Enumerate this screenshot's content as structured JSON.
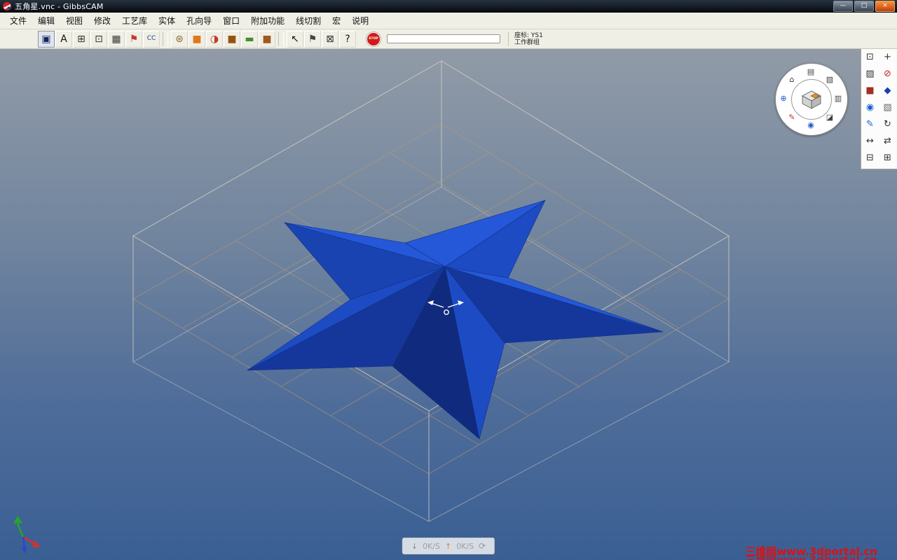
{
  "window": {
    "title": "五角星.vnc - GibbsCAM",
    "controls": [
      {
        "name": "minimize-button",
        "glyph": "—"
      },
      {
        "name": "maximize-button",
        "glyph": "□"
      },
      {
        "name": "close-button",
        "glyph": "×"
      }
    ]
  },
  "menu": {
    "items": [
      "文件",
      "编辑",
      "视图",
      "修改",
      "工艺库",
      "实体",
      "孔向导",
      "窗口",
      "附加功能",
      "线切割",
      "宏",
      "说明"
    ]
  },
  "toolbar": {
    "buttons": [
      {
        "name": "document-view-button",
        "glyph": "▣",
        "fg": "#12235e",
        "pressed": true
      },
      {
        "name": "text-tool-button",
        "glyph": "A",
        "fg": "#111111"
      },
      {
        "name": "sheet-stack-button",
        "glyph": "⊞",
        "fg": "#333333"
      },
      {
        "name": "marquee-select-button",
        "glyph": "⊡",
        "fg": "#333333"
      },
      {
        "name": "grid-toggle-button",
        "glyph": "▦",
        "fg": "#333333"
      },
      {
        "name": "flag-tool-button",
        "glyph": "⚑",
        "fg": "#c03a2a"
      },
      {
        "name": "cc-tool-button",
        "glyph": "CC",
        "fg": "#23408e"
      },
      {
        "type": "sep"
      },
      {
        "name": "blade-tool-button",
        "glyph": "⊛",
        "fg": "#8a6a2a"
      },
      {
        "name": "stock-solid-button",
        "glyph": "■",
        "fg": "#e07818"
      },
      {
        "name": "revolve-solid-button",
        "glyph": "◑",
        "fg": "#c0392b"
      },
      {
        "name": "block-solid-button",
        "glyph": "■",
        "fg": "#96520f"
      },
      {
        "name": "sweep-solid-button",
        "glyph": "▬",
        "fg": "#3f8f2f"
      },
      {
        "name": "body-solid-button",
        "glyph": "■",
        "fg": "#a05a20"
      },
      {
        "type": "sep"
      },
      {
        "name": "cursor-tool-button",
        "glyph": "↖",
        "fg": "#111111"
      },
      {
        "name": "flag-small-button",
        "glyph": "⚑",
        "fg": "#444444"
      },
      {
        "name": "pick-box-button",
        "glyph": "⊠",
        "fg": "#333333"
      },
      {
        "name": "context-help-button",
        "glyph": "?",
        "fg": "#111111"
      }
    ],
    "stop_label": "STOP",
    "coord_label": "座标: YS1",
    "group_label": "工作群组"
  },
  "right_panel": {
    "icons": [
      {
        "name": "new-part-icon",
        "glyph": "▤",
        "color": "#444444"
      },
      {
        "name": "spline-tool-icon",
        "glyph": "≈",
        "color": "#1b5fd0"
      },
      {
        "name": "frame-tool-icon",
        "glyph": "⊡",
        "color": "#333333"
      },
      {
        "name": "cs-axis-icon",
        "glyph": "+",
        "color": "#333333"
      },
      {
        "name": "hatch-tool-icon",
        "glyph": "▨",
        "color": "#333333"
      },
      {
        "name": "erase-tool-icon",
        "glyph": "⊘",
        "color": "#c02222"
      },
      {
        "name": "workbook-icon",
        "glyph": "■",
        "color": "#a03020"
      },
      {
        "name": "solids-icon",
        "glyph": "◆",
        "color": "#1b3fb0"
      },
      {
        "name": "visibility-eye-icon",
        "glyph": "◉",
        "color": "#1b5fd0"
      },
      {
        "name": "cube-tool-icon",
        "glyph": "▧",
        "color": "#666666"
      },
      {
        "name": "pencil-tool-icon",
        "glyph": "✎",
        "color": "#1b5fd0"
      },
      {
        "name": "redraw-icon",
        "glyph": "↻",
        "color": "#333333"
      },
      {
        "name": "dimension-icon",
        "glyph": "↔",
        "color": "#333333"
      },
      {
        "name": "mirror-icon",
        "glyph": "⇄",
        "color": "#333333"
      },
      {
        "name": "sheets-icon",
        "glyph": "⊟",
        "color": "#333333"
      },
      {
        "name": "copy-icon",
        "glyph": "⊞",
        "color": "#333333"
      }
    ]
  },
  "viewcube": {
    "icons": [
      {
        "name": "home-view-icon",
        "glyph": "⌂",
        "color": "#333333"
      },
      {
        "name": "top-view-icon",
        "glyph": "▤",
        "color": "#444444"
      },
      {
        "name": "cube-view-icon",
        "glyph": "▧",
        "color": "#444444"
      },
      {
        "name": "right-view-icon",
        "glyph": "▥",
        "color": "#444444"
      },
      {
        "name": "iso-view-icon",
        "glyph": "◪",
        "color": "#444444"
      },
      {
        "name": "eye-view-icon",
        "glyph": "◉",
        "color": "#2255cc"
      },
      {
        "name": "draw-view-icon",
        "glyph": "✎",
        "color": "#c03030"
      },
      {
        "name": "target-view-icon",
        "glyph": "⊕",
        "color": "#2255cc"
      }
    ]
  },
  "status": {
    "down_icon": "↓",
    "down_label": "0K/S",
    "up_icon": "↑",
    "up_label": "0K/S",
    "refresh_icon": "⟳"
  },
  "watermark": {
    "text": "三维网www.3dportal.cn",
    "color": "#e01010"
  },
  "scene": {
    "star_color": "#1d4bc4",
    "box_edge_color": "#d8cfc0",
    "grid_color": "#c09a70",
    "bg_top": "#919ba7",
    "bg_bottom": "#3a5f94"
  }
}
